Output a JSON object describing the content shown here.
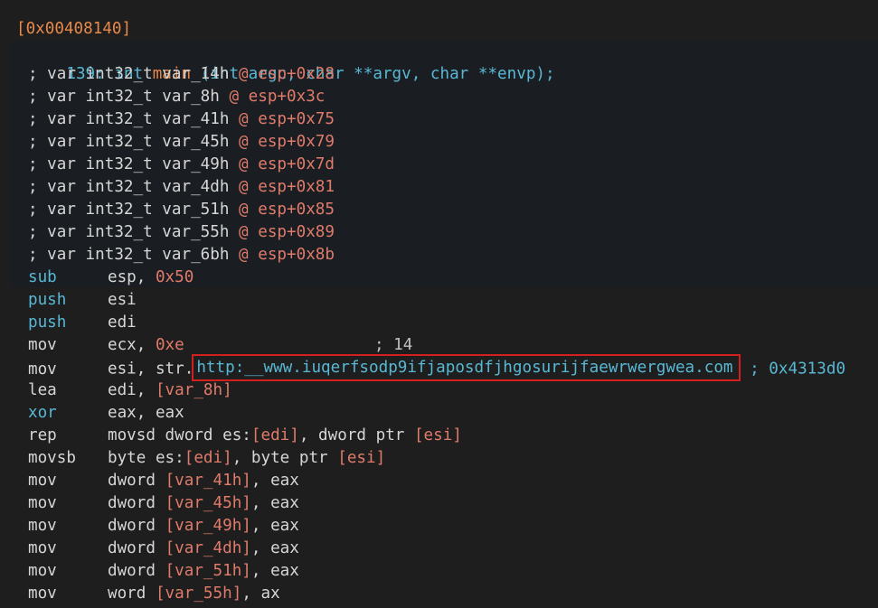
{
  "address": "[0x00408140]",
  "signature": {
    "prefix": "139:",
    "ret": "int",
    "name": "main",
    "args": "(int argc, char **argv, char **envp);"
  },
  "vars": [
    {
      "name": "var_14h",
      "off": "esp+0x28"
    },
    {
      "name": "var_8h",
      "off": "esp+0x3c"
    },
    {
      "name": "var_41h",
      "off": "esp+0x75"
    },
    {
      "name": "var_45h",
      "off": "esp+0x79"
    },
    {
      "name": "var_49h",
      "off": "esp+0x7d"
    },
    {
      "name": "var_4dh",
      "off": "esp+0x81"
    },
    {
      "name": "var_51h",
      "off": "esp+0x85"
    },
    {
      "name": "var_55h",
      "off": "esp+0x89"
    },
    {
      "name": "var_6bh",
      "off": "esp+0x8b"
    }
  ],
  "var_prefix": "; var int32_t",
  "var_at": "@",
  "instructions": {
    "i1": {
      "op": "sub",
      "a": "esp,",
      "b": "0x50"
    },
    "i2": {
      "op": "push",
      "a": "esi"
    },
    "i3": {
      "op": "push",
      "a": "edi"
    },
    "i4": {
      "op": "mov",
      "a": "ecx,",
      "b": "0xe",
      "c": "; 14"
    },
    "i5": {
      "op": "mov",
      "a": "esi,",
      "b": "str.",
      "url": "http:__www.iuqerfsodp9ifjaposdfjhgosurijfaewrwergwea.com",
      "c": "; 0x4313d0"
    },
    "i6": {
      "op": "lea",
      "a": "edi,",
      "b": "[var_8h]"
    },
    "i7": {
      "op": "xor",
      "a": "eax, eax"
    },
    "i8": {
      "op": "rep",
      "a": "movsd dword es:",
      "b": "[edi]",
      "c": ", dword ptr ",
      "d": "[esi]"
    },
    "i9": {
      "op": "movsb",
      "a": "byte es:",
      "b": "[edi]",
      "c": ", byte ptr ",
      "d": "[esi]"
    },
    "i10": {
      "op": "mov",
      "a": "dword ",
      "b": "[var_41h]",
      "c": ", eax"
    },
    "i11": {
      "op": "mov",
      "a": "dword ",
      "b": "[var_45h]",
      "c": ", eax"
    },
    "i12": {
      "op": "mov",
      "a": "dword ",
      "b": "[var_49h]",
      "c": ", eax"
    },
    "i13": {
      "op": "mov",
      "a": "dword ",
      "b": "[var_4dh]",
      "c": ", eax"
    },
    "i14": {
      "op": "mov",
      "a": "dword ",
      "b": "[var_51h]",
      "c": ", eax"
    },
    "i15": {
      "op": "mov",
      "a": "word ",
      "b": "[var_55h]",
      "c": ", ax"
    }
  },
  "colors": {
    "background": "#1e1e1e",
    "header": "#1a1e22",
    "blue": "#58b8d4",
    "orange": "#e8894a",
    "red": "#e07b6b",
    "highlight": "#d41f1f"
  }
}
